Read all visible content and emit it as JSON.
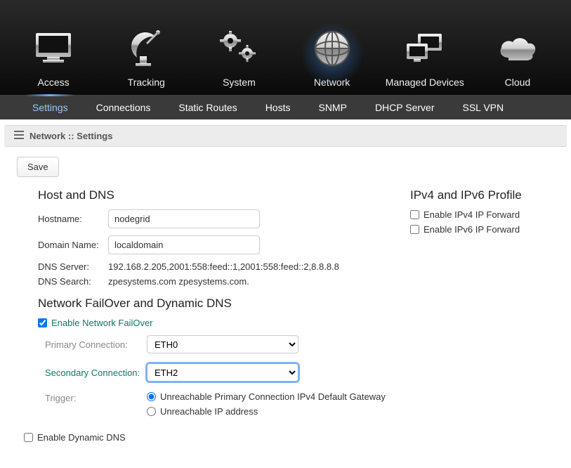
{
  "topnav": [
    {
      "key": "access",
      "label": "Access"
    },
    {
      "key": "tracking",
      "label": "Tracking"
    },
    {
      "key": "system",
      "label": "System"
    },
    {
      "key": "network",
      "label": "Network",
      "active": true
    },
    {
      "key": "managed",
      "label": "Managed Devices"
    },
    {
      "key": "cloud",
      "label": "Cloud"
    }
  ],
  "subnav": [
    {
      "key": "settings",
      "label": "Settings",
      "active": true
    },
    {
      "key": "connections",
      "label": "Connections"
    },
    {
      "key": "static-routes",
      "label": "Static Routes"
    },
    {
      "key": "hosts",
      "label": "Hosts"
    },
    {
      "key": "snmp",
      "label": "SNMP"
    },
    {
      "key": "dhcp",
      "label": "DHCP Server"
    },
    {
      "key": "sslvpn",
      "label": "SSL VPN"
    }
  ],
  "breadcrumb": "Network :: Settings",
  "save_label": "Save",
  "host_dns": {
    "heading": "Host and DNS",
    "hostname_label": "Hostname:",
    "hostname_value": "nodegrid",
    "domain_label": "Domain Name:",
    "domain_value": "localdomain",
    "dns_server_label": "DNS Server:",
    "dns_server_value": "192.168.2.205,2001:558:feed::1,2001:558:feed::2,8.8.8.8",
    "dns_search_label": "DNS Search:",
    "dns_search_value": "zpesystems.com zpesystems.com."
  },
  "failover": {
    "heading": "Network FailOver and Dynamic DNS",
    "enable_label": "Enable Network FailOver",
    "enable_checked": true,
    "primary_label": "Primary Connection:",
    "primary_value": "ETH0",
    "secondary_label": "Secondary Connection:",
    "secondary_value": "ETH2",
    "trigger_label": "Trigger:",
    "trigger_opts": [
      {
        "key": "gw",
        "label": "Unreachable Primary Connection IPv4 Default Gateway",
        "checked": true
      },
      {
        "key": "ip",
        "label": "Unreachable IP address",
        "checked": false
      }
    ],
    "dyndns_label": "Enable Dynamic DNS",
    "dyndns_checked": false
  },
  "ipv_profile": {
    "heading": "IPv4 and IPv6 Profile",
    "v4_label": "Enable IPv4 IP Forward",
    "v4_checked": false,
    "v6_label": "Enable IPv6 IP Forward",
    "v6_checked": false
  }
}
